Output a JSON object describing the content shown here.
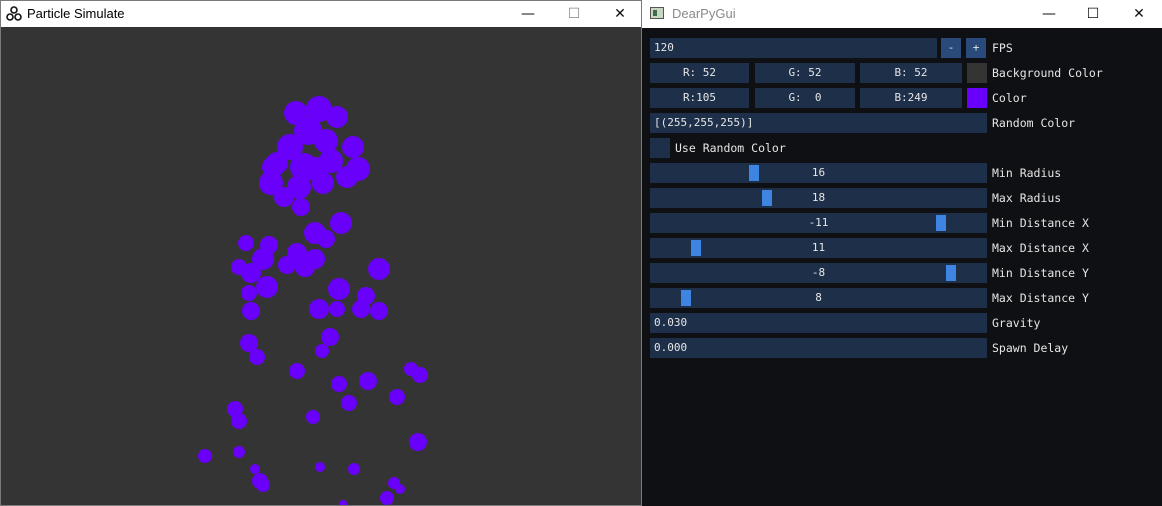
{
  "left_window": {
    "title": "Particle Simulate",
    "controls": {
      "minimize": "—",
      "maximize": "☐",
      "close": "✕"
    },
    "background_color": "#343434",
    "particle_color": "#6900f9"
  },
  "right_window": {
    "title": "DearPyGui",
    "controls": {
      "minimize": "—",
      "maximize": "☐",
      "close": "✕"
    },
    "fps": {
      "value": "120",
      "minus": "-",
      "plus": "+",
      "label": "FPS"
    },
    "background_color": {
      "r": "R: 52",
      "g": "G: 52",
      "b": "B: 52",
      "label": "Background Color",
      "swatch": "#343434"
    },
    "color": {
      "r": "R:105",
      "g": "G:  0",
      "b": "B:249",
      "label": "Color",
      "swatch": "#6900f9"
    },
    "random_color": {
      "value": "[(255,255,255)]",
      "label": "Random Color"
    },
    "use_random_color": {
      "label": "Use Random Color",
      "checked": false
    },
    "sliders": [
      {
        "name": "min-radius",
        "label": "Min Radius",
        "value": "16",
        "fraction": 0.3
      },
      {
        "name": "max-radius",
        "label": "Max Radius",
        "value": "18",
        "fraction": 0.34
      },
      {
        "name": "min-distance-x",
        "label": "Min Distance X",
        "value": "-11",
        "fraction": 0.88
      },
      {
        "name": "max-distance-x",
        "label": "Max Distance X",
        "value": "11",
        "fraction": 0.12
      },
      {
        "name": "min-distance-y",
        "label": "Min Distance Y",
        "value": "-8",
        "fraction": 0.91
      },
      {
        "name": "max-distance-y",
        "label": "Max Distance Y",
        "value": "8",
        "fraction": 0.09
      }
    ],
    "gravity": {
      "value": "0.030",
      "label": "Gravity"
    },
    "spawn_delay": {
      "value": "0.000",
      "label": "Spawn Delay"
    }
  }
}
